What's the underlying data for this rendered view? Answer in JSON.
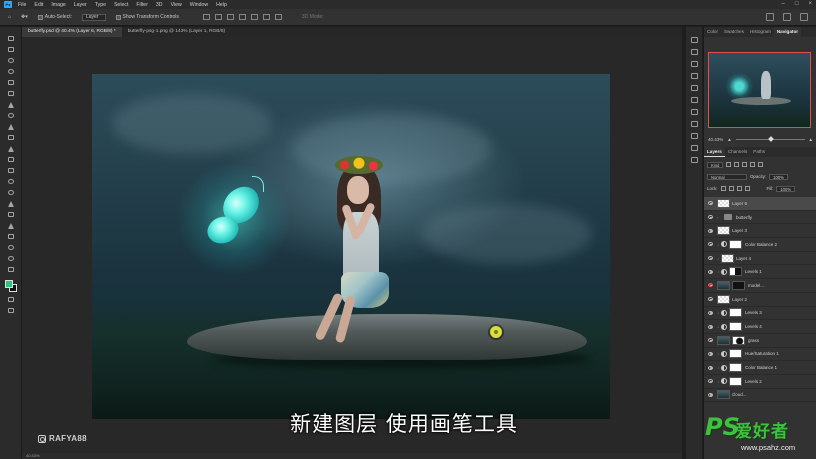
{
  "menubar": {
    "app_badge": "Ps",
    "items": [
      "File",
      "Edit",
      "Image",
      "Layer",
      "Type",
      "Select",
      "Filter",
      "3D",
      "View",
      "Window",
      "Help"
    ]
  },
  "options": {
    "auto_select_label": "Auto-Select:",
    "auto_select_target": "Layer",
    "show_transform_label": "Show Transform Controls",
    "mode_3d_label": "3D Mode:"
  },
  "doc_tabs": [
    "butterfly.psd @ 40.4% (Layer 6, RGB/8) *",
    "butterfly-psg-1.png @ 143% (Layer 1, RGB/8)"
  ],
  "canvas": {
    "brand_watermark": "RAFYA88",
    "subtitle": "新建图层 使用画笔工具",
    "foreground_color": "#2ec27e"
  },
  "statusbar": {
    "zoom": "40.43%"
  },
  "panels": {
    "top_tabs": [
      "Color",
      "Swatches",
      "Histogram",
      "Navigator"
    ],
    "active_top_tab": "Navigator",
    "nav_zoom": "40.43%",
    "layer_tabs": [
      "Layers",
      "Channels",
      "Paths"
    ],
    "filter_kind": "Kind",
    "blend_mode": "Normal",
    "opacity_label": "Opacity:",
    "opacity_value": "100%",
    "lock_label": "Lock:",
    "fill_label": "Fill:",
    "fill_value": "100%"
  },
  "layers": [
    {
      "name": "Layer 6",
      "thumb": "checker",
      "selected": true
    },
    {
      "name": "butterfly",
      "thumb": "folder"
    },
    {
      "name": "Layer 3",
      "thumb": "checker"
    },
    {
      "name": "Color Balance 2",
      "thumb": "adj",
      "mask": "white"
    },
    {
      "name": "Layer 4",
      "thumb": "checker"
    },
    {
      "name": "Levels 1",
      "thumb": "adj",
      "mask": "bw"
    },
    {
      "name": "model...",
      "thumb": "photo",
      "mask": "black",
      "eye_red": true
    },
    {
      "name": "Layer 2",
      "thumb": "checker"
    },
    {
      "name": "Levels 3",
      "thumb": "adj",
      "mask": "white"
    },
    {
      "name": "Levels 4",
      "thumb": "adj",
      "mask": "white"
    },
    {
      "name": "grass",
      "thumb": "photo",
      "mask": "black"
    },
    {
      "name": "Hue/Saturation 1",
      "thumb": "adj",
      "mask": "white"
    },
    {
      "name": "Color Balance 1",
      "thumb": "adj",
      "mask": "white"
    },
    {
      "name": "Levels 2",
      "thumb": "adj",
      "mask": "white"
    },
    {
      "name": "cloud...",
      "thumb": "photo"
    }
  ],
  "site_watermark": {
    "ps": "PS",
    "cn": "爱好者",
    "url": "www.psahz.com"
  }
}
